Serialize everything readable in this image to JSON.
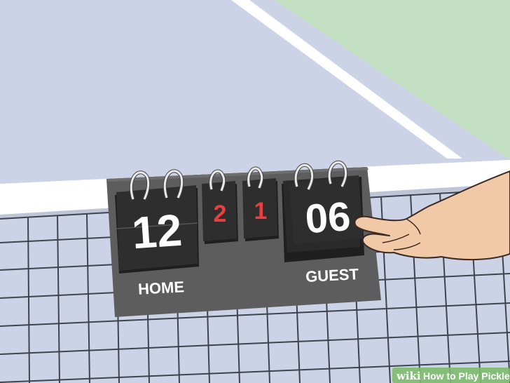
{
  "scoreboard": {
    "home_score": "12",
    "home_label": "HOME",
    "game_left": "2",
    "game_right": "1",
    "guest_score": "06",
    "guest_label": "GUEST"
  },
  "watermark": {
    "brand": "wiki",
    "title": "How to Play Pickle"
  },
  "colors": {
    "court": "#cdd3e6",
    "grass": "#c3e1c2",
    "board": "#5d5d5d",
    "card": "#2e2e2e",
    "game_digit": "#e8403f",
    "skin": "#f2c9a6"
  }
}
